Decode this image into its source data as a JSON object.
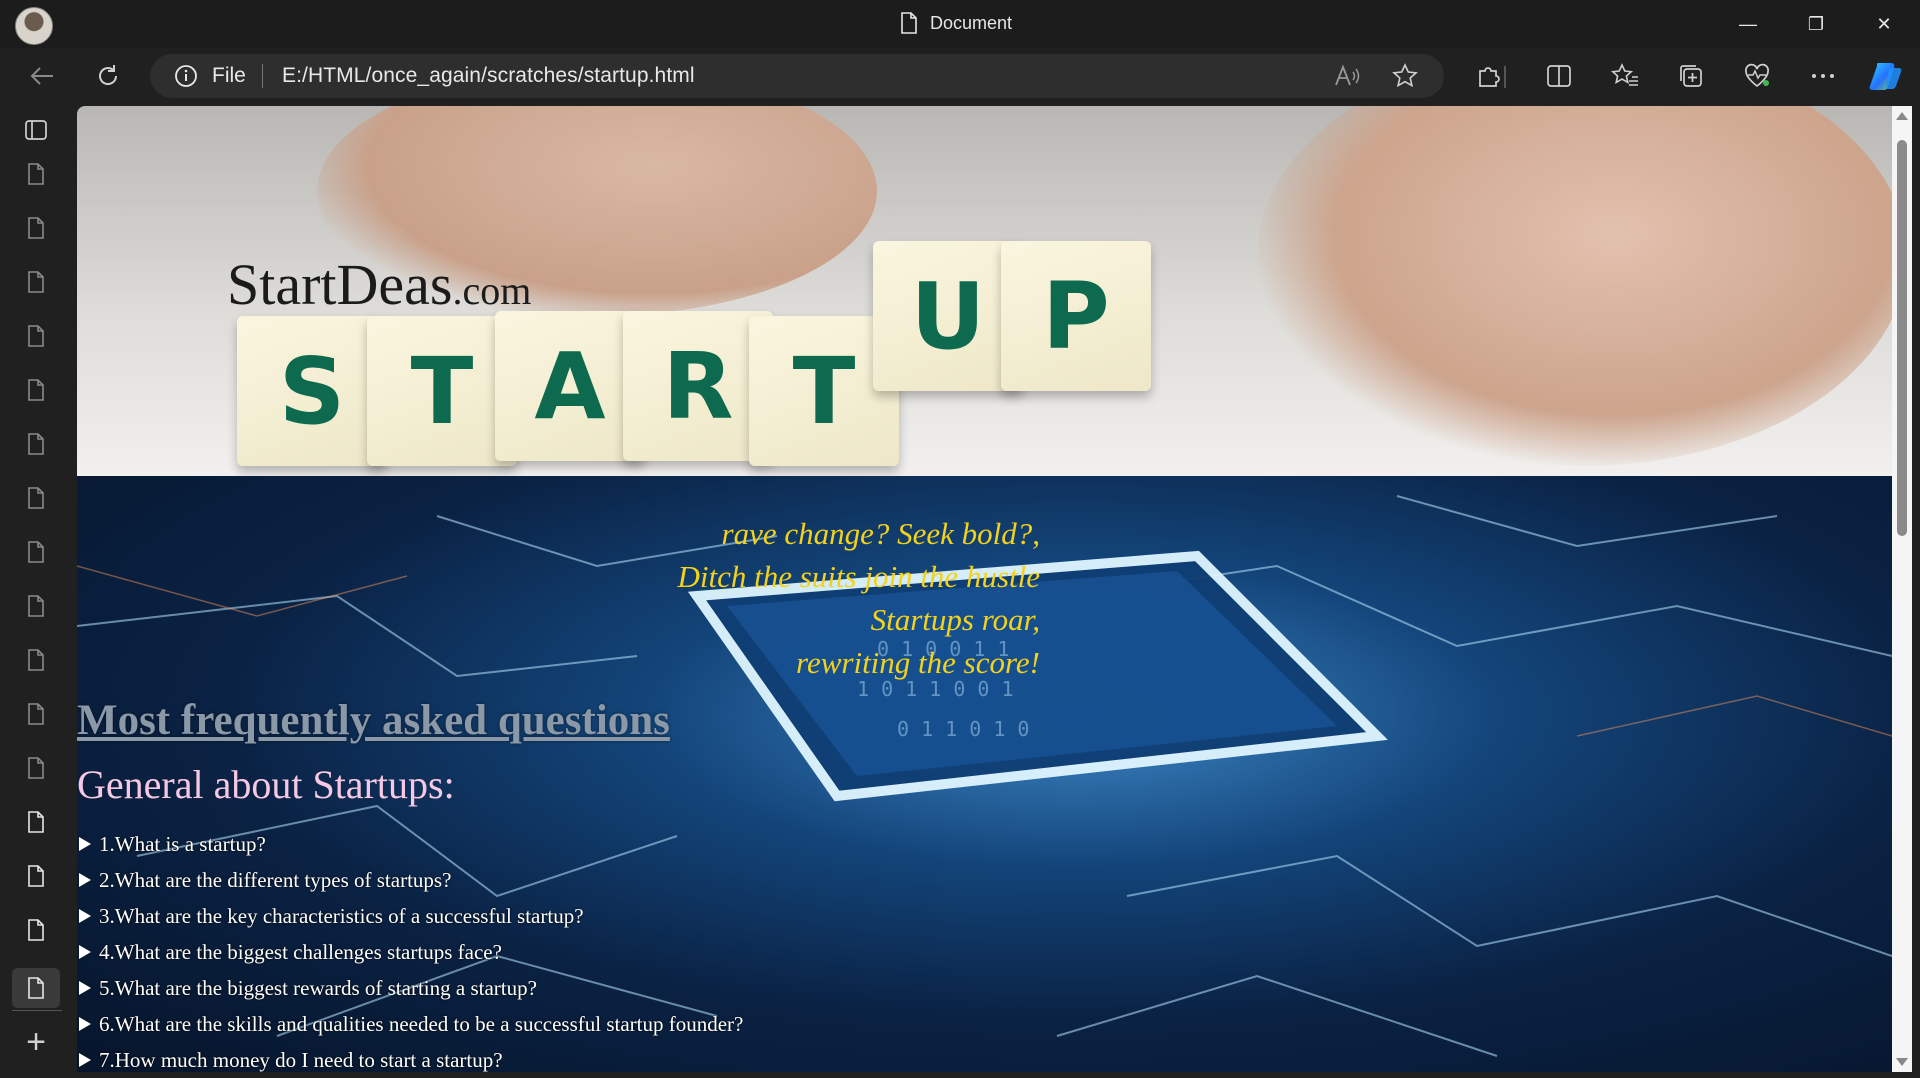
{
  "window": {
    "title": "Document",
    "minimize_symbol": "—",
    "restore_symbol": "❐",
    "close_symbol": "✕"
  },
  "toolbar": {
    "address_prefix": "File",
    "url": "E:/HTML/once_again/scratches/startup.html",
    "icons": [
      "back-icon",
      "refresh-icon",
      "info-icon",
      "read-aloud-icon",
      "favorite-star-icon",
      "extensions-icon",
      "split-screen-icon",
      "favorites-icon",
      "collections-icon",
      "browser-essentials-icon",
      "more-icon",
      "copilot-icon"
    ]
  },
  "sidebar": {
    "tab_count": 16,
    "add_symbol": "+"
  },
  "page": {
    "brand_main": "StartDeas",
    "brand_suffix": ".com",
    "hero_tiles": [
      "S",
      "T",
      "A",
      "R",
      "T",
      "U",
      "P"
    ],
    "poem": [
      "rave change? Seek bold?,",
      "Ditch the suits join the hustle",
      "Startups roar,",
      "rewriting the score!"
    ],
    "faq_heading": "Most frequently asked questions",
    "faq_subheading": "General about Startups:",
    "faq_items": [
      "1.What is a startup?",
      "2.What are the different types of startups?",
      "3.What are the key characteristics of a successful startup?",
      "4.What are the biggest challenges startups face?",
      "5.What are the biggest rewards of starting a startup?",
      "6.What are the skills and qualities needed to be a successful startup founder?",
      "7.How much money do I need to start a startup?"
    ]
  },
  "colors": {
    "poem": "#f3d21c",
    "faq_subheading": "#f6c8e3",
    "tile_letters": "#0e6a4e",
    "chrome_bg": "#202020"
  }
}
